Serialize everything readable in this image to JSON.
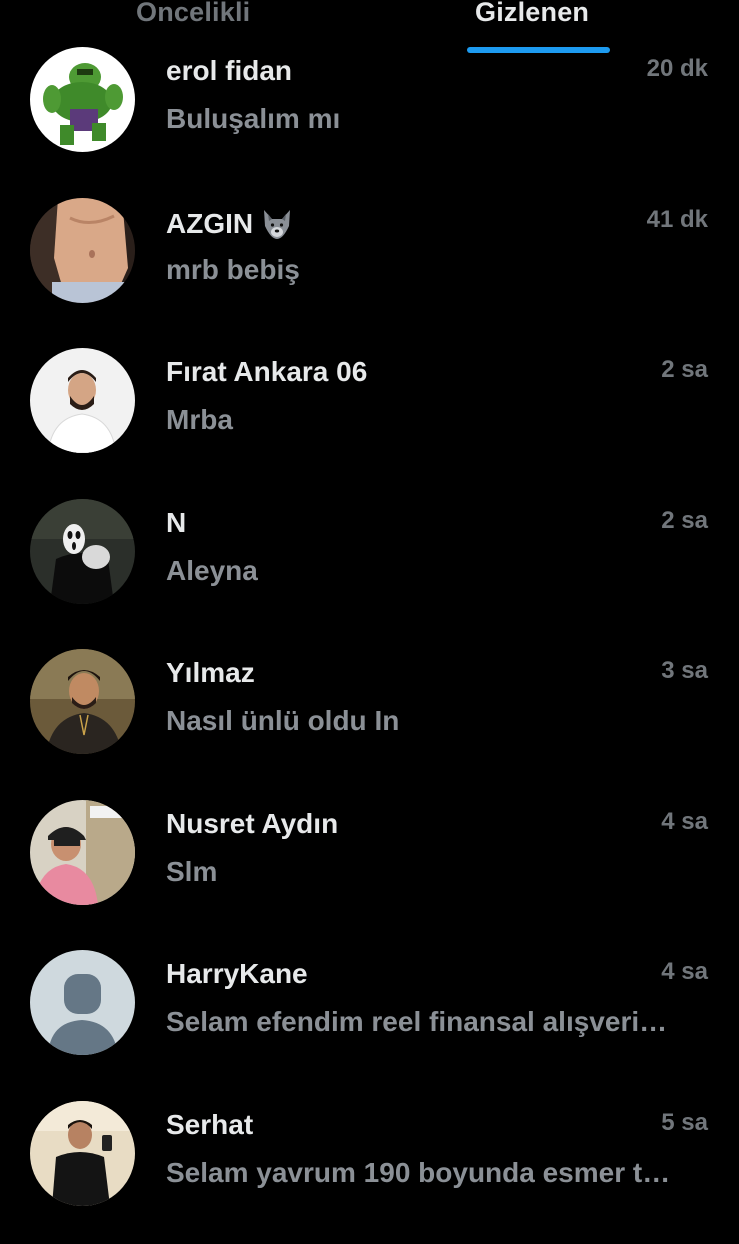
{
  "tabs": {
    "left_label": "Oncelikli",
    "right_label": "Gizlenen",
    "active": "Gizlenen",
    "indicator_color": "#1d9bf0"
  },
  "conversations": [
    {
      "name": "erol fidan",
      "time": "20 dk",
      "preview": "Buluşalım mı",
      "avatar": "hulk-avatar-icon"
    },
    {
      "name": "AZGIN",
      "name_emoji": "wolf-emoji-icon",
      "time": "41 dk",
      "preview": "mrb bebiş",
      "avatar": "shirtless-torso-avatar-icon"
    },
    {
      "name": "Fırat Ankara 06",
      "time": "2 sa",
      "preview": "Mrba",
      "avatar": "man-white-shirt-avatar-icon"
    },
    {
      "name": "N",
      "time": "2 sa",
      "preview": "Aleyna",
      "avatar": "ghostface-mask-avatar-icon"
    },
    {
      "name": "Yılmaz",
      "time": "3 sa",
      "preview": "Nasıl ünlü oldu In",
      "avatar": "man-selfie-avatar-icon"
    },
    {
      "name": "Nusret Aydın",
      "time": "4 sa",
      "preview": "Slm",
      "avatar": "man-cap-pink-shirt-avatar-icon"
    },
    {
      "name": "HarryKane",
      "time": "4 sa",
      "preview": "Selam efendim reel finansal alışveri…",
      "avatar": "default-profile-avatar-icon"
    },
    {
      "name": "Serhat",
      "time": "5 sa",
      "preview": "Selam yavrum 190 boyunda esmer t…",
      "avatar": "mirror-selfie-avatar-icon"
    }
  ]
}
